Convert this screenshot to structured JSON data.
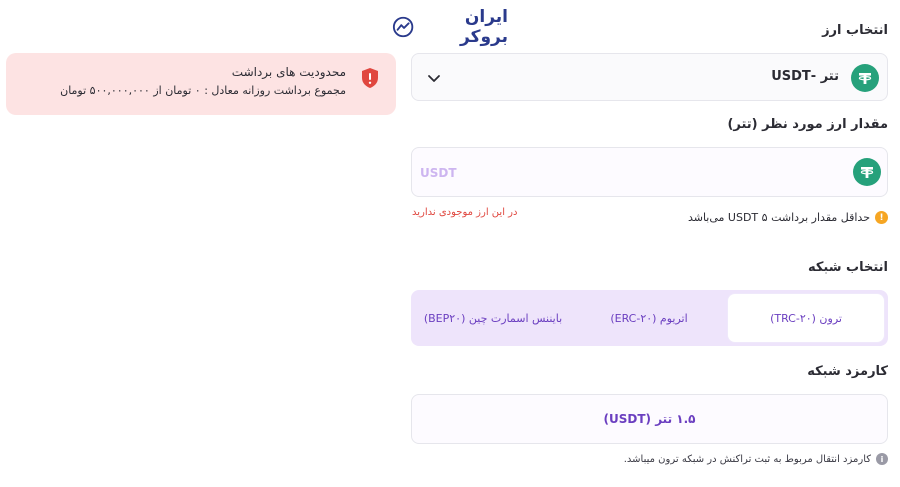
{
  "brand": {
    "logo_text": "ایران بروکر"
  },
  "currency_section": {
    "title": "انتخاب ارز",
    "selected_label": "تتر -USDT",
    "icon": "tether-icon"
  },
  "amount_section": {
    "title": "مقدار ارز مورد نظر (تتر)",
    "placeholder": "USDT",
    "value": "",
    "icon": "tether-icon"
  },
  "hints": {
    "min_withdraw": "حداقل مقدار برداشت ۵ USDT می‌باشد",
    "min_withdraw_icon_glyph": "!",
    "no_balance": "در این ارز موجودی ندارید"
  },
  "network_section": {
    "title": "انتخاب شبکه",
    "tabs": [
      {
        "label": "ترون (TRC-۲۰)",
        "active": true
      },
      {
        "label": "اتریوم (ERC-۲۰)",
        "active": false
      },
      {
        "label": "بایننس اسمارت چین (BEP۲۰)",
        "active": false
      }
    ]
  },
  "fee_section": {
    "title": "کارمزد شبکه",
    "value": "۱.۵ تتر (USDT)",
    "hint": "کارمزد انتقال مربوط به ثبت تراکنش در شبکه ترون میباشد.",
    "hint_icon_glyph": "i"
  },
  "limits_card": {
    "title": "محدودیت های برداشت",
    "text": "مجموع برداشت روزانه معادل : ۰ تومان از ۵۰۰,۰۰۰,۰۰۰ تومان",
    "icon_glyph": "!"
  },
  "colors": {
    "accent": "#6b3fc0",
    "tether_green": "#26a17b",
    "warning_red": "#e0473f",
    "limit_bg": "#fde3e3",
    "tab_bg": "#eee4fb"
  }
}
